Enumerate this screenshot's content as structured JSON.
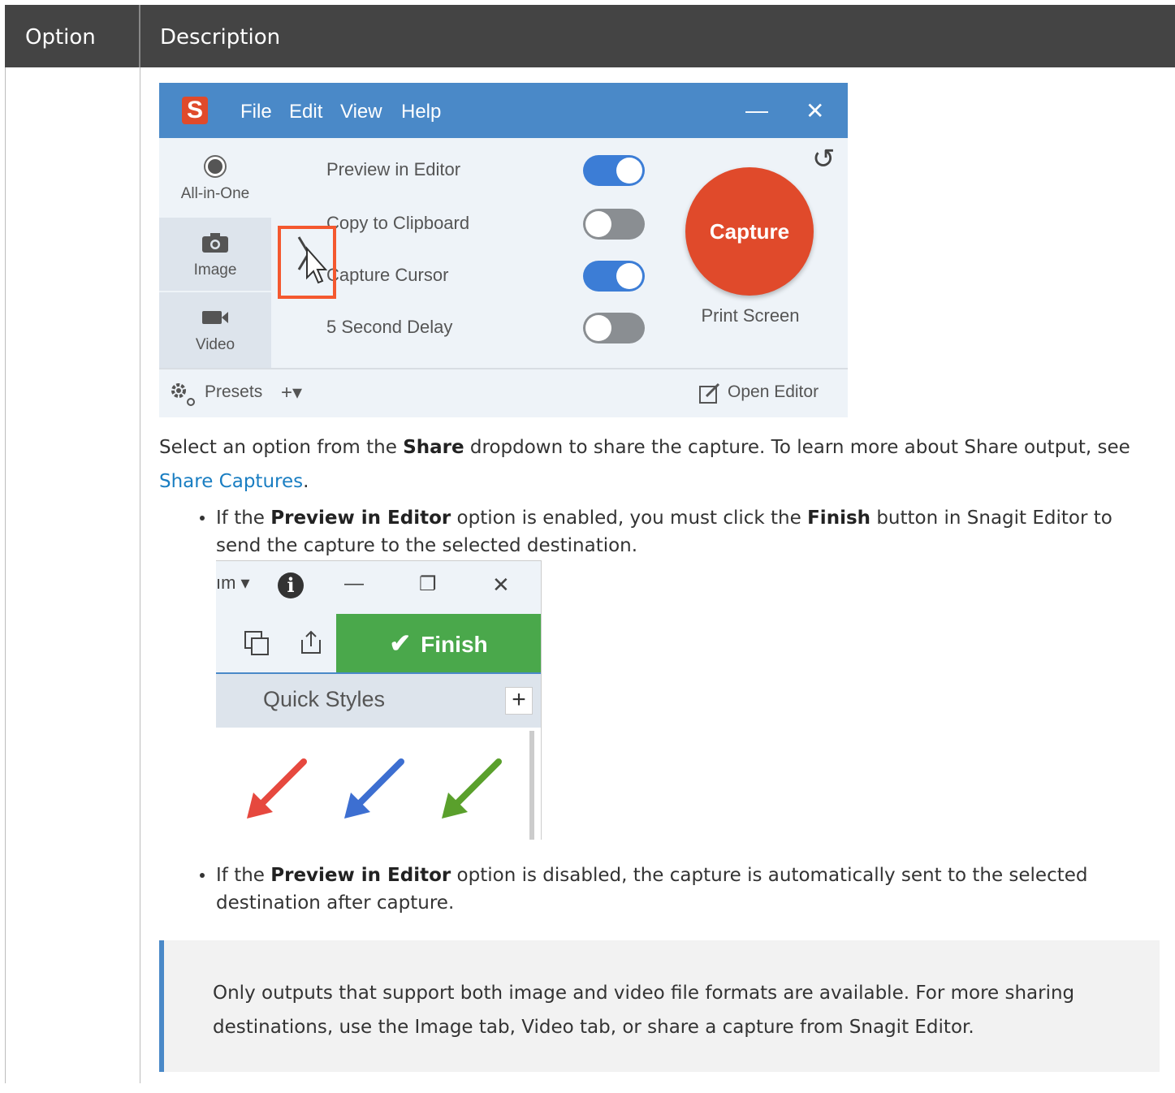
{
  "table": {
    "header": {
      "option": "Option",
      "description": "Description"
    }
  },
  "snagit": {
    "logo_letter": "S",
    "menu": [
      "File",
      "Edit",
      "View",
      "Help"
    ],
    "minimize": "—",
    "close": "✕",
    "reset": "↺",
    "tabs": [
      {
        "label": "All-in-One",
        "icon": "radio-icon",
        "selected": false
      },
      {
        "label": "Image",
        "icon": "camera-icon",
        "selected": true
      },
      {
        "label": "Video",
        "icon": "video-camera-icon",
        "selected": false
      }
    ],
    "options": [
      {
        "label": "Preview in Editor",
        "enabled": true
      },
      {
        "label": "Copy to Clipboard",
        "enabled": false
      },
      {
        "label": "Capture Cursor",
        "enabled": true
      },
      {
        "label": "5 Second Delay",
        "enabled": false
      }
    ],
    "capture_label": "Capture",
    "hotkey_label": "Print Screen",
    "presets_label": "Presets",
    "add_label": "+▾",
    "open_editor_label": "Open Editor"
  },
  "intro": {
    "t1": "Select an option from the ",
    "share": "Share",
    "t2": " dropdown to share the capture. To learn more about Share output, see ",
    "link": "Share Captures",
    "t3": "."
  },
  "bullet1": {
    "t1": "If the ",
    "b1": "Preview in Editor",
    "t2": " option is enabled, you must click the ",
    "b2": "Finish",
    "t3": " button in Snagit Editor to send the capture to the selected destination."
  },
  "editor": {
    "partial_menu": "ım ▾",
    "info": "i",
    "minimize": "—",
    "restore": "❐",
    "close": "✕",
    "finish_label": "Finish",
    "quick_styles_label": "Quick Styles",
    "plus": "+",
    "colors": {
      "red": "#e6483e",
      "blue": "#3d6fd1",
      "green": "#5aa02c"
    }
  },
  "bullet2": {
    "t1": "If the ",
    "b1": "Preview in Editor",
    "t2": " option is disabled, the capture is automatically sent to the selected destination after capture."
  },
  "note": {
    "text": "Only outputs that support both image and video file formats are available. For more sharing destinations, use the Image tab, Video tab, or share a capture from Snagit Editor."
  }
}
